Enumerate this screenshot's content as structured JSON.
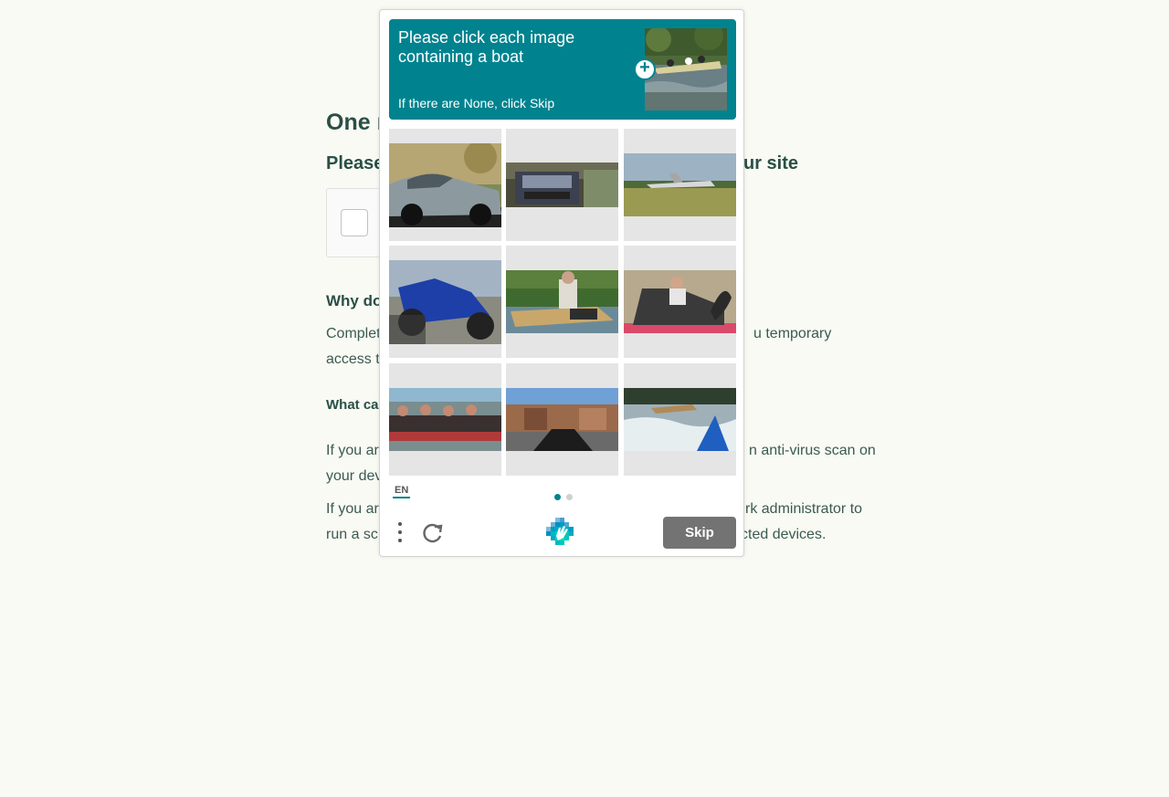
{
  "page": {
    "heading": "One m",
    "subheading_left": "Please",
    "subheading_right": "ur site",
    "section1_title": "Why do",
    "section1_line1_left": "Complet",
    "section1_line1_right": "u temporary",
    "section1_line2_left": "access t",
    "section2_title": "What ca",
    "para2_line1_left": "If you ar",
    "para2_line1_right": "n anti-virus scan on",
    "para2_line2_left": "your dev",
    "para3_line1_left": "If you ar",
    "para3_line1_right": "rk administrator to",
    "para3_line2_left": "run a sc",
    "para3_line2_right": "cted devices."
  },
  "challenge": {
    "prompt_title": "Please click each image containing a boat",
    "prompt_subtitle": "If there are None, click Skip",
    "language": "EN",
    "skip_label": "Skip",
    "accent_color": "#00838f",
    "page_count": 2,
    "current_page": 1,
    "tiles": [
      "car",
      "vehicle-front",
      "airplane",
      "motorcycle",
      "boat-driver",
      "swan-boat",
      "rowing-crew",
      "street-motorbike",
      "kayak-rapids"
    ],
    "icons": [
      "zoom-in-icon",
      "menu-dots-icon",
      "refresh-icon",
      "hcaptcha-logo-icon"
    ]
  }
}
